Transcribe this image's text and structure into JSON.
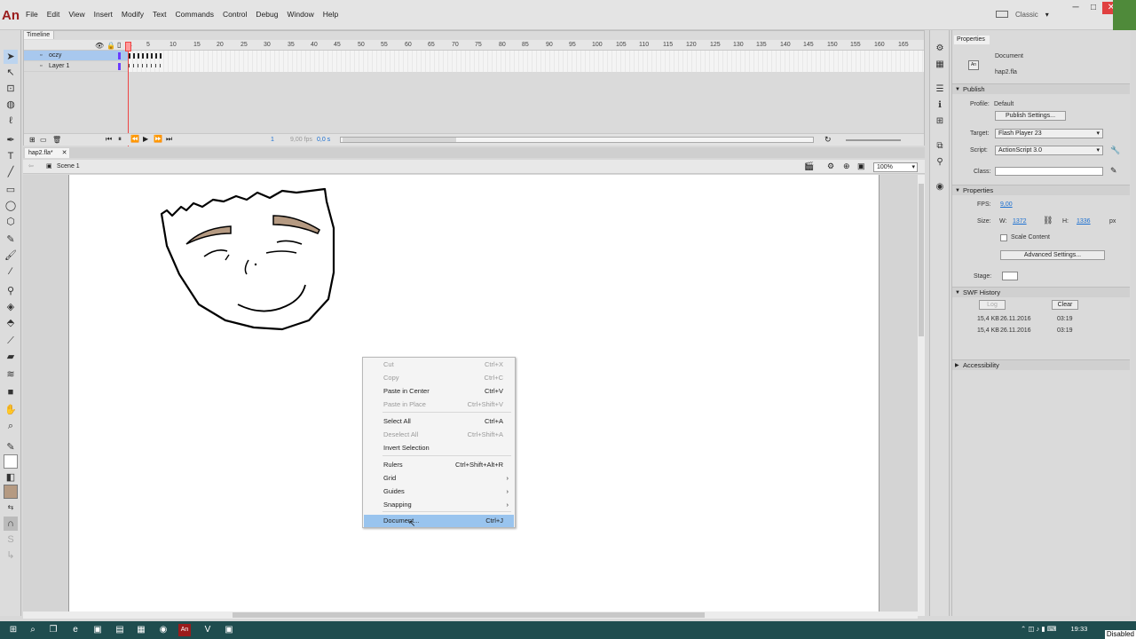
{
  "app": {
    "logo": "An"
  },
  "menu": [
    "File",
    "Edit",
    "View",
    "Insert",
    "Modify",
    "Text",
    "Commands",
    "Control",
    "Debug",
    "Window",
    "Help"
  ],
  "workspace": {
    "label": "Classic",
    "arrow": "▾"
  },
  "window_controls": {
    "min": "─",
    "max": "□",
    "close": "✕"
  },
  "timeline": {
    "tab": "Timeline",
    "frame_numbers": [
      "1",
      "5",
      "10",
      "15",
      "20",
      "25",
      "30",
      "35",
      "40",
      "45",
      "50",
      "55",
      "60",
      "65",
      "70",
      "75",
      "80",
      "85",
      "90",
      "95",
      "100",
      "105",
      "110",
      "115",
      "120",
      "125",
      "130",
      "135",
      "140",
      "145",
      "150",
      "155",
      "160",
      "165"
    ],
    "layers": [
      {
        "name": "oczy",
        "selected": true
      },
      {
        "name": "Layer 1",
        "selected": false
      }
    ],
    "footer": {
      "frame": "1",
      "fps": "9,00 fps",
      "time": "0,0 s"
    }
  },
  "document": {
    "tab": "hap2.fla*",
    "close": "✕",
    "scene": "Scene 1",
    "zoom": "100%"
  },
  "context_menu": [
    {
      "label": "Cut",
      "shortcut": "Ctrl+X",
      "disabled": true
    },
    {
      "label": "Copy",
      "shortcut": "Ctrl+C",
      "disabled": true
    },
    {
      "label": "Paste in Center",
      "shortcut": "Ctrl+V",
      "disabled": false
    },
    {
      "label": "Paste in Place",
      "shortcut": "Ctrl+Shift+V",
      "disabled": true
    },
    {
      "label": "Select All",
      "shortcut": "Ctrl+A",
      "disabled": false
    },
    {
      "label": "Deselect All",
      "shortcut": "Ctrl+Shift+A",
      "disabled": true
    },
    {
      "label": "Invert Selection",
      "shortcut": "",
      "disabled": false
    },
    {
      "label": "Rulers",
      "shortcut": "Ctrl+Shift+Alt+R",
      "disabled": false
    },
    {
      "label": "Grid",
      "shortcut": "",
      "submenu": true
    },
    {
      "label": "Guides",
      "shortcut": "",
      "submenu": true
    },
    {
      "label": "Snapping",
      "shortcut": "",
      "submenu": true
    },
    {
      "label": "Document...",
      "shortcut": "Ctrl+J",
      "highlighted": true
    }
  ],
  "properties": {
    "tab": "Properties",
    "doc_type": "Document",
    "file": "hap2.fla",
    "publish": {
      "title": "Publish",
      "profile_label": "Profile:",
      "profile": "Default",
      "settings_btn": "Publish Settings...",
      "target_label": "Target:",
      "target": "Flash Player 23",
      "script_label": "Script:",
      "script": "ActionScript 3.0",
      "class_label": "Class:"
    },
    "props": {
      "title": "Properties",
      "fps_label": "FPS:",
      "fps": "9,00",
      "size_label": "Size:",
      "w_label": "W:",
      "w": "1372",
      "h_label": "H:",
      "h": "1336",
      "unit": "px",
      "scale_content": "Scale Content",
      "advanced_btn": "Advanced Settings...",
      "stage_label": "Stage:"
    },
    "swf_history": {
      "title": "SWF History",
      "log_btn": "Log",
      "clear_btn": "Clear",
      "rows": [
        {
          "size": "15,4 KB",
          "date": "26.11.2016",
          "time": "03:19"
        },
        {
          "size": "15,4 KB",
          "date": "26.11.2016",
          "time": "03:19"
        }
      ]
    },
    "accessibility": "Accessibility"
  },
  "taskbar": {
    "clock": "19:33",
    "status": "Disabled"
  },
  "colors": {
    "highlight": "#99c4ee",
    "taskbar": "#1f4d4f",
    "brow": "#b59a82"
  }
}
